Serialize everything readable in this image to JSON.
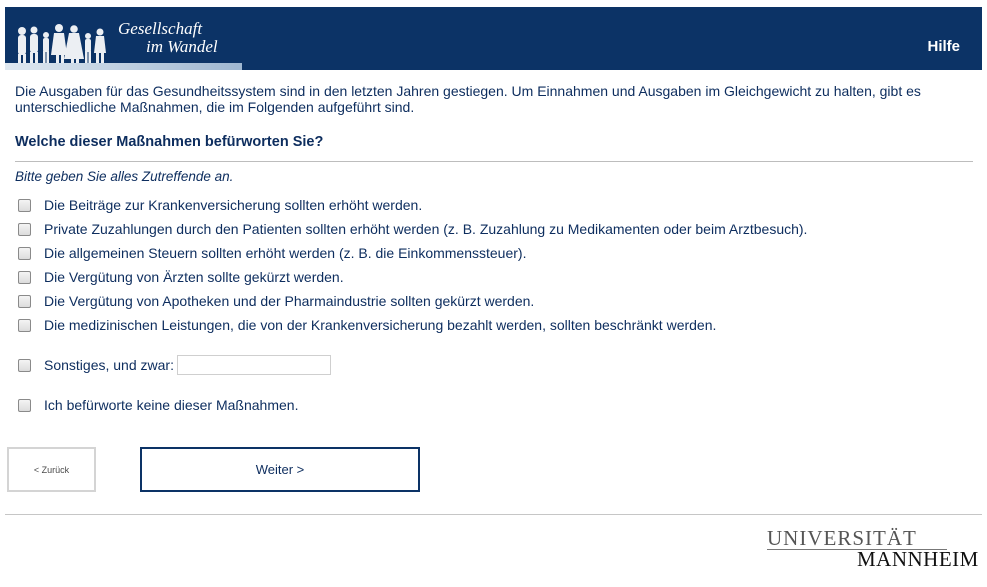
{
  "header": {
    "logo_line1": "Gesellschaft",
    "logo_line2": "im Wandel",
    "help_label": "Hilfe"
  },
  "intro_text": "Die Ausgaben für das Gesundheitssystem sind in den letzten Jahren gestiegen. Um Einnahmen und Ausgaben im Gleichgewicht zu halten, gibt es unterschiedliche Maßnahmen, die im Folgenden aufgeführt sind.",
  "question": "Welche dieser Maßnahmen befürworten Sie?",
  "instruction": "Bitte geben Sie alles Zutreffende an.",
  "options": [
    "Die Beiträge zur Krankenversicherung sollten erhöht werden.",
    "Private Zuzahlungen durch den Patienten sollten erhöht werden (z. B. Zuzahlung zu Medikamenten oder beim Arztbesuch).",
    "Die allgemeinen Steuern sollten erhöht werden (z. B. die Einkommenssteuer).",
    "Die Vergütung von Ärzten sollte gekürzt werden.",
    "Die Vergütung von Apotheken und der Pharmaindustrie sollten gekürzt werden.",
    "Die medizinischen Leistungen, die von der Krankenversicherung bezahlt werden, sollten beschränkt werden."
  ],
  "other_option": {
    "label": "Sonstiges, und zwar:",
    "value": ""
  },
  "none_option": "Ich befürworte keine dieser Maßnahmen.",
  "nav": {
    "back_label": "< Zurück",
    "next_label": "Weiter >"
  },
  "footer": {
    "logo_line1": "UNIVERSITÄT",
    "logo_line2": "MANNHEIM"
  },
  "colors": {
    "header_bg": "#0c3366",
    "text": "#0d2d5e"
  }
}
